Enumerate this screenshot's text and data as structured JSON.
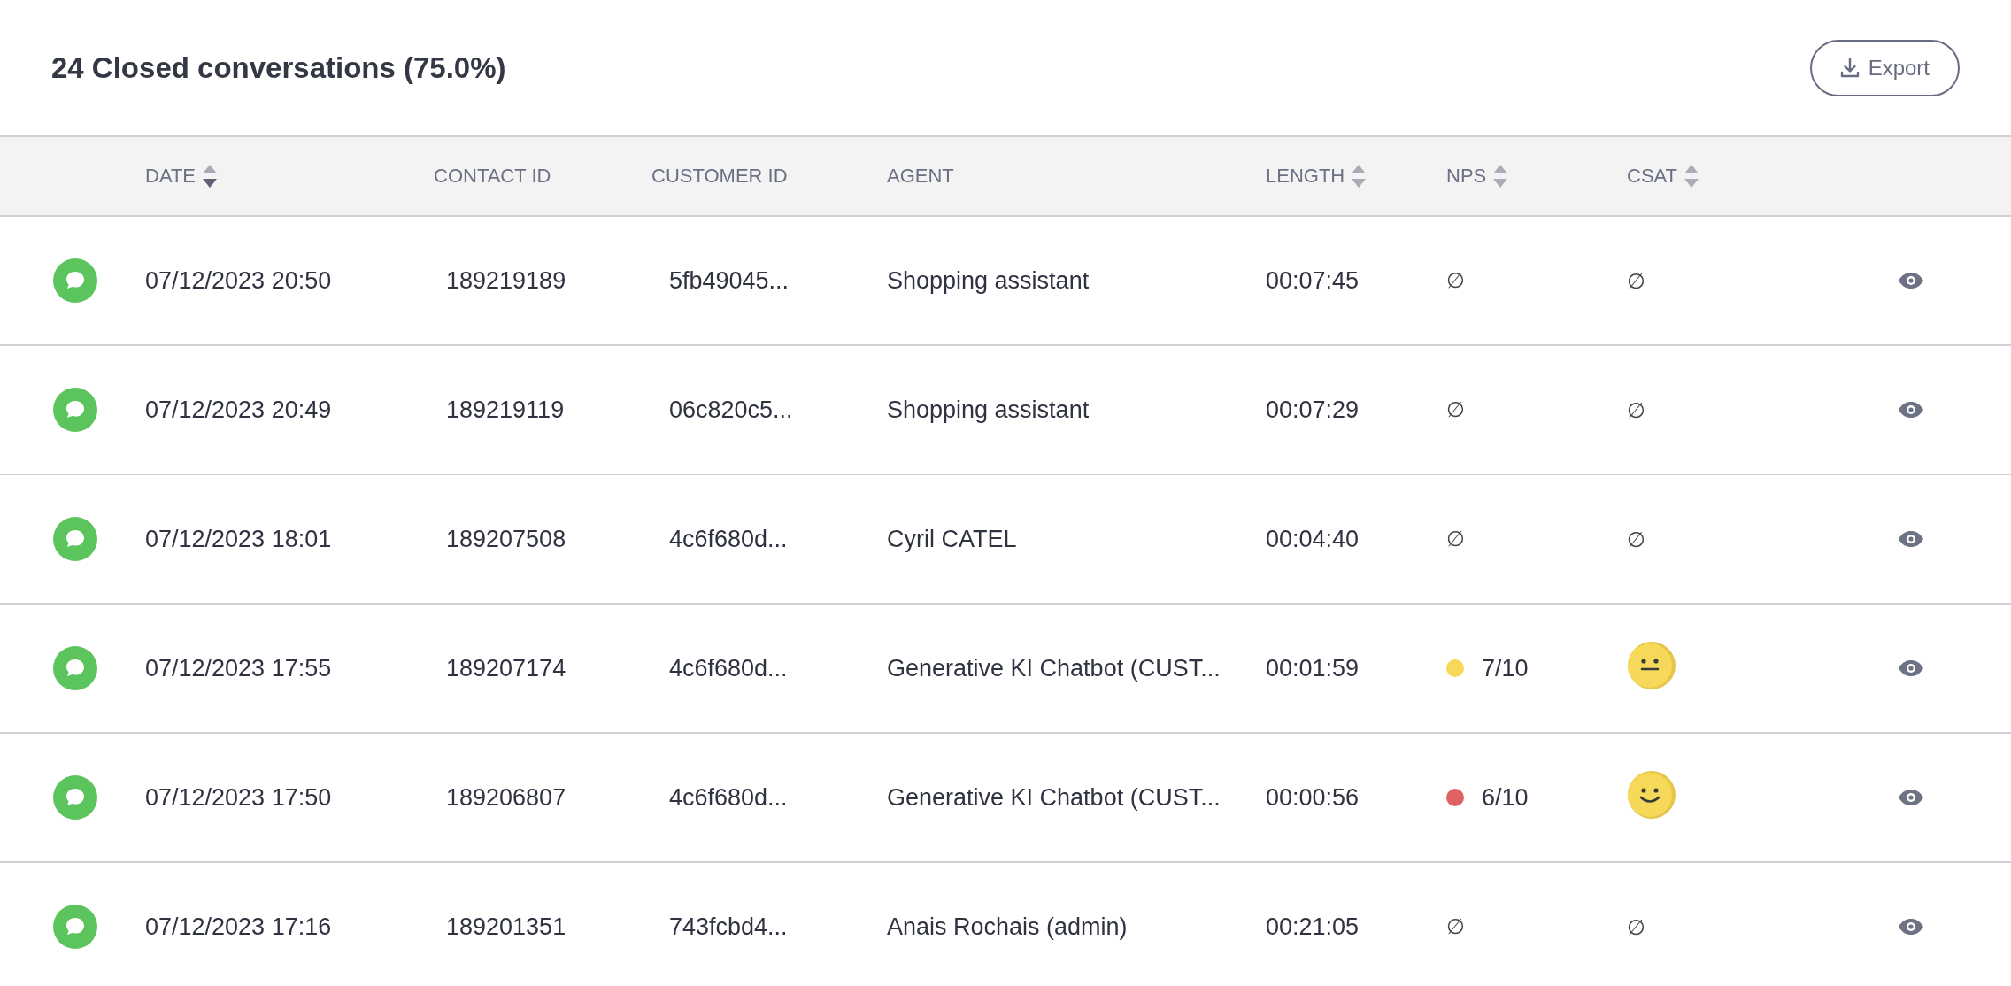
{
  "title": "24 Closed conversations (75.0%)",
  "export_button": "Export",
  "table": {
    "columns": [
      {
        "label": "DATE",
        "kind": "sortable",
        "sorted": true
      },
      {
        "label": "CONTACT ID",
        "kind": "plain"
      },
      {
        "label": "CUSTOMER ID",
        "kind": "plain"
      },
      {
        "label": "AGENT",
        "kind": "plain"
      },
      {
        "label": "LENGTH",
        "kind": "sortable",
        "sorted": false
      },
      {
        "label": "NPS",
        "kind": "sortable",
        "sorted": false
      },
      {
        "label": "CSAT",
        "kind": "sortable",
        "sorted": false
      }
    ],
    "rows": [
      {
        "date": "07/12/2023 20:50",
        "contact_id": "189219189",
        "customer_id": "5fb49045...",
        "agent": "Shopping assistant",
        "length": "00:07:45",
        "nps": {
          "text": "∅"
        },
        "csat": {
          "kind": "empty",
          "text": "∅"
        }
      },
      {
        "date": "07/12/2023 20:49",
        "contact_id": "189219119",
        "customer_id": "06c820c5...",
        "agent": "Shopping assistant",
        "length": "00:07:29",
        "nps": {
          "text": "∅"
        },
        "csat": {
          "kind": "empty",
          "text": "∅"
        }
      },
      {
        "date": "07/12/2023 18:01",
        "contact_id": "189207508",
        "customer_id": "4c6f680d...",
        "agent": "Cyril CATEL",
        "length": "00:04:40",
        "nps": {
          "text": "∅"
        },
        "csat": {
          "kind": "empty",
          "text": "∅"
        }
      },
      {
        "date": "07/12/2023 17:55",
        "contact_id": "189207174",
        "customer_id": "4c6f680d...",
        "agent": "Generative KI Chatbot (CUST...",
        "length": "00:01:59",
        "nps": {
          "text": "7/10",
          "color": "#f7d95a"
        },
        "csat": {
          "kind": "neutral"
        }
      },
      {
        "date": "07/12/2023 17:50",
        "contact_id": "189206807",
        "customer_id": "4c6f680d...",
        "agent": "Generative KI Chatbot (CUST...",
        "length": "00:00:56",
        "nps": {
          "text": "6/10",
          "color": "#e06161"
        },
        "csat": {
          "kind": "smile"
        }
      },
      {
        "date": "07/12/2023 17:16",
        "contact_id": "189201351",
        "customer_id": "743fcbd4...",
        "agent": "Anais Rochais (admin)",
        "length": "00:21:05",
        "nps": {
          "text": "∅"
        },
        "csat": {
          "kind": "empty",
          "text": "∅"
        }
      }
    ]
  }
}
